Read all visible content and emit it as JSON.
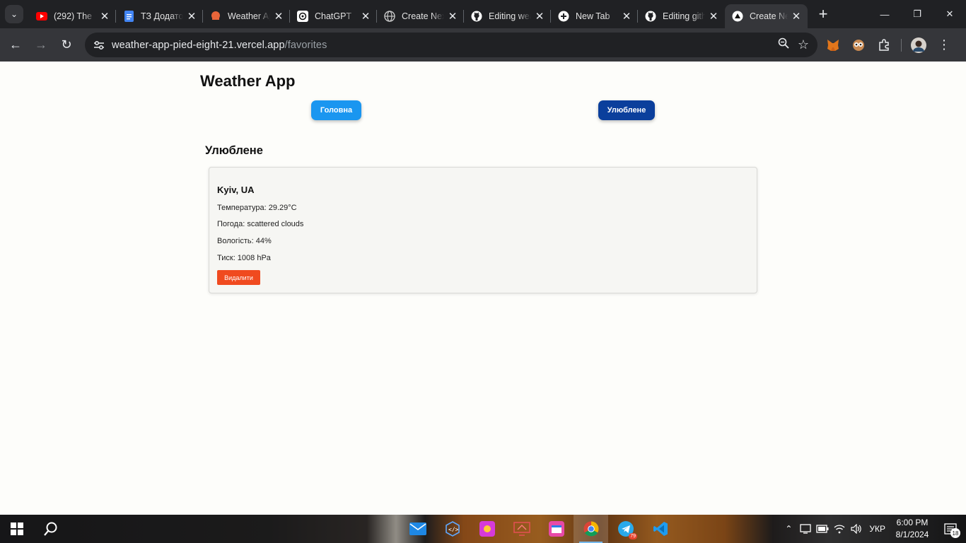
{
  "browser": {
    "tabs": [
      {
        "title": "(292) The",
        "favicon": "youtube-icon",
        "active": false
      },
      {
        "title": "ТЗ Додаток",
        "favicon": "google-docs-icon",
        "active": false
      },
      {
        "title": "Weather App",
        "favicon": "weather-app-icon",
        "active": false
      },
      {
        "title": "ChatGPT",
        "favicon": "chatgpt-icon",
        "active": false
      },
      {
        "title": "Create Next App",
        "favicon": "globe-icon",
        "active": false
      },
      {
        "title": "Editing weather-app",
        "favicon": "github-icon",
        "active": false
      },
      {
        "title": "New Tab",
        "favicon": "new-tab-icon",
        "active": false
      },
      {
        "title": "Editing github",
        "favicon": "github-icon",
        "active": false
      },
      {
        "title": "Create Next App",
        "favicon": "vercel-icon",
        "active": true
      }
    ],
    "address": {
      "host": "weather-app-pied-eight-21.vercel.app",
      "path": "/favorites"
    }
  },
  "app": {
    "title": "Weather App",
    "nav": {
      "home_label": "Головна",
      "favorites_label": "Улюблене"
    },
    "section_title": "Улюблене",
    "favorites": [
      {
        "city": "Kyiv, UA",
        "temperature": "Температура: 29.29°C",
        "weather": "Погода: scattered clouds",
        "humidity": "Вологість: 44%",
        "pressure": "Тиск: 1008 hPa",
        "delete_label": "Видалити"
      }
    ],
    "colors": {
      "home_button": "#1a96f0",
      "favorites_button": "#0b3f9c",
      "delete_button": "#f04a1f"
    }
  },
  "taskbar": {
    "apps": [
      "mail-icon",
      "code-editor-icon",
      "paint-icon",
      "remote-desktop-icon",
      "calendar-icon",
      "chrome-icon",
      "telegram-icon",
      "vscode-icon"
    ],
    "telegram_badge": "79",
    "language": "УКР",
    "time": "6:00 PM",
    "date": "8/1/2024",
    "notification_count": "18"
  }
}
